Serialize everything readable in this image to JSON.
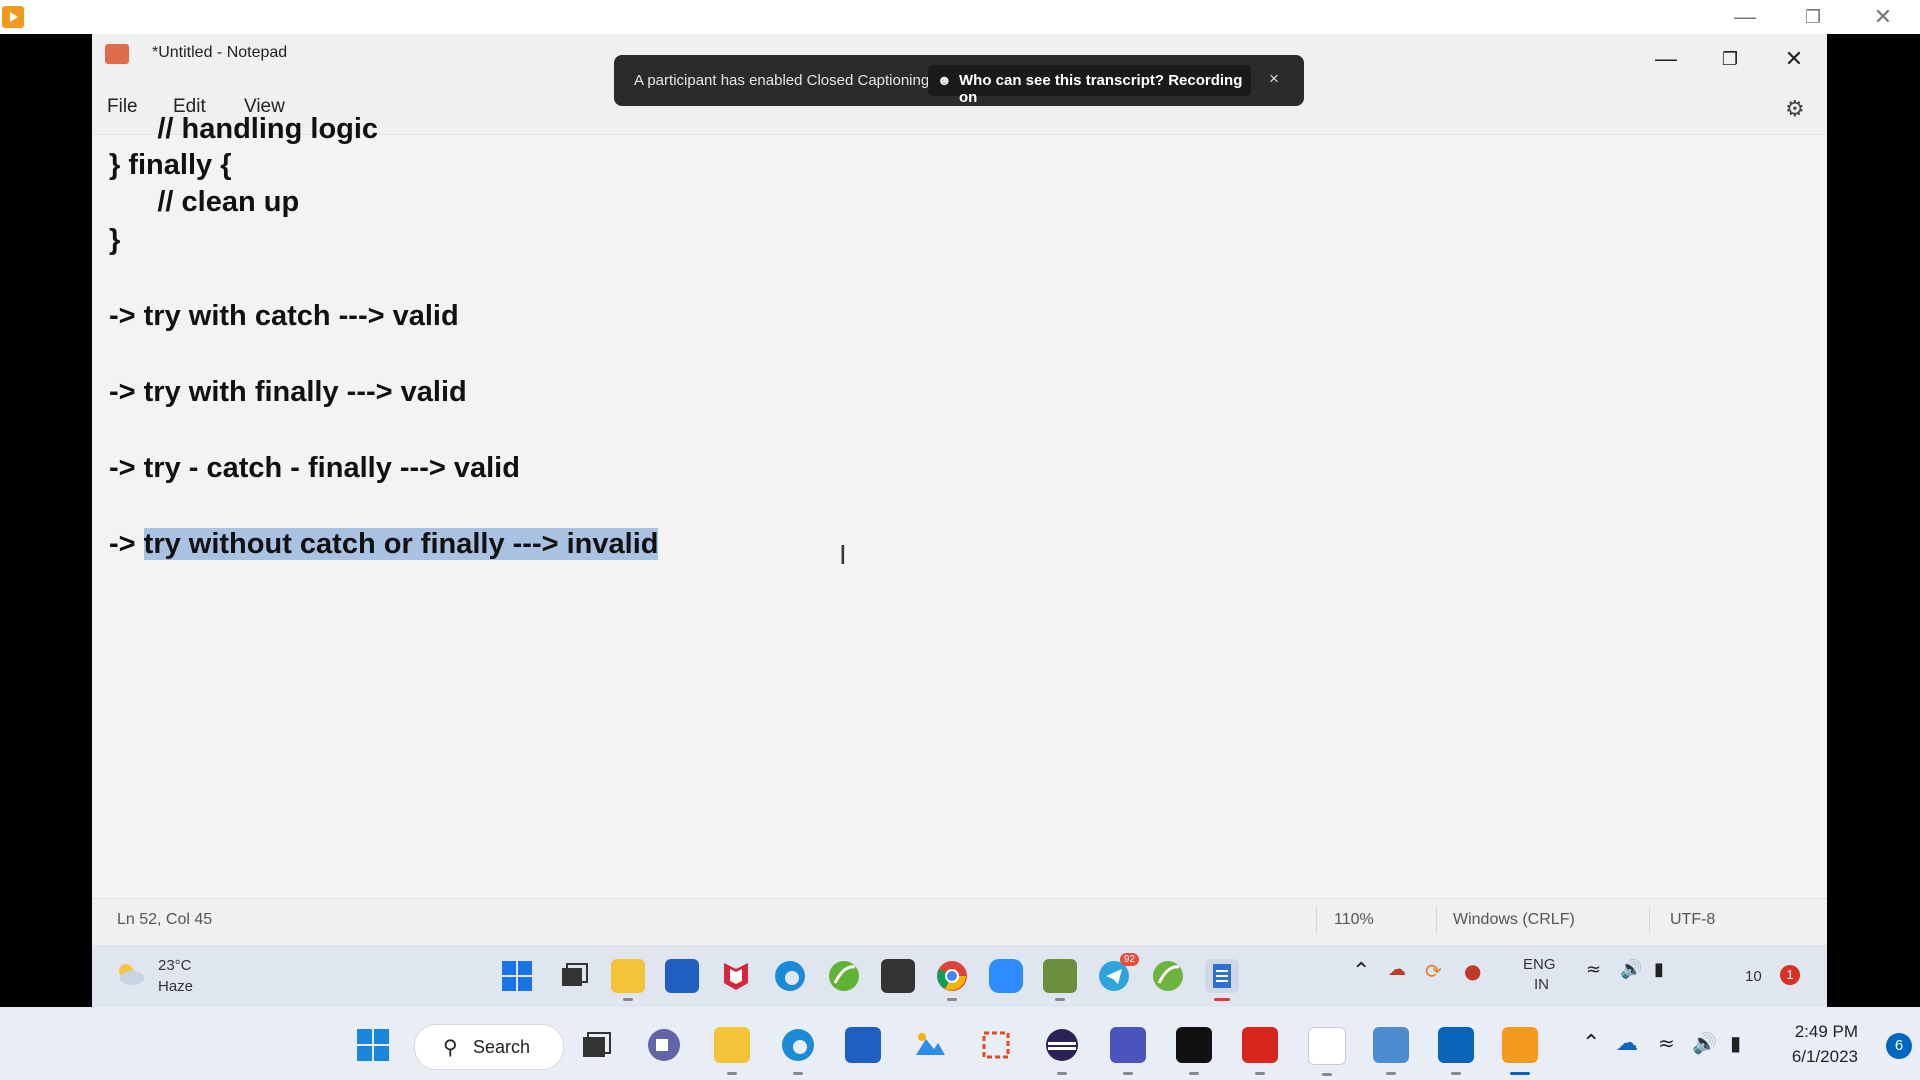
{
  "notepad": {
    "title": "*Untitled - Notepad",
    "menu": [
      "File",
      "Edit",
      "View"
    ],
    "lines": [
      {
        "text": "      // handling logic",
        "indent": false
      },
      {
        "text": "} finally {"
      },
      {
        "text": "      // clean up"
      },
      {
        "text": "}"
      },
      {
        "text": "-> try with catch ---> valid"
      },
      {
        "text": "-> try with finally ---> valid"
      },
      {
        "text": "-> try - catch - finally ---> valid"
      },
      {
        "prefix": "-> ",
        "selected": "try without catch or finally ---> invalid"
      }
    ],
    "status": {
      "position": "Ln 52, Col 45",
      "zoom": "110%",
      "line_ending": "Windows (CRLF)",
      "encoding": "UTF-8"
    }
  },
  "captions_toast": {
    "message": "A participant has enabled Closed Captioning",
    "link": "Who can see this transcript? Recording on",
    "close": "×"
  },
  "inner_taskbar": {
    "weather_temp": "23°C",
    "weather_cond": "Haze",
    "telegram_badge": "92",
    "lang_top": "ENG",
    "lang_bottom": "IN",
    "tray_count": "10",
    "notif_count": "1"
  },
  "host_taskbar": {
    "search_label": "Search",
    "time": "2:49 PM",
    "date": "6/1/2023",
    "notif_count": "6"
  },
  "colors": {
    "selection": "#a9c2e2",
    "toast_bg": "#2b2b2b",
    "taskbar": "#e9eef6"
  }
}
